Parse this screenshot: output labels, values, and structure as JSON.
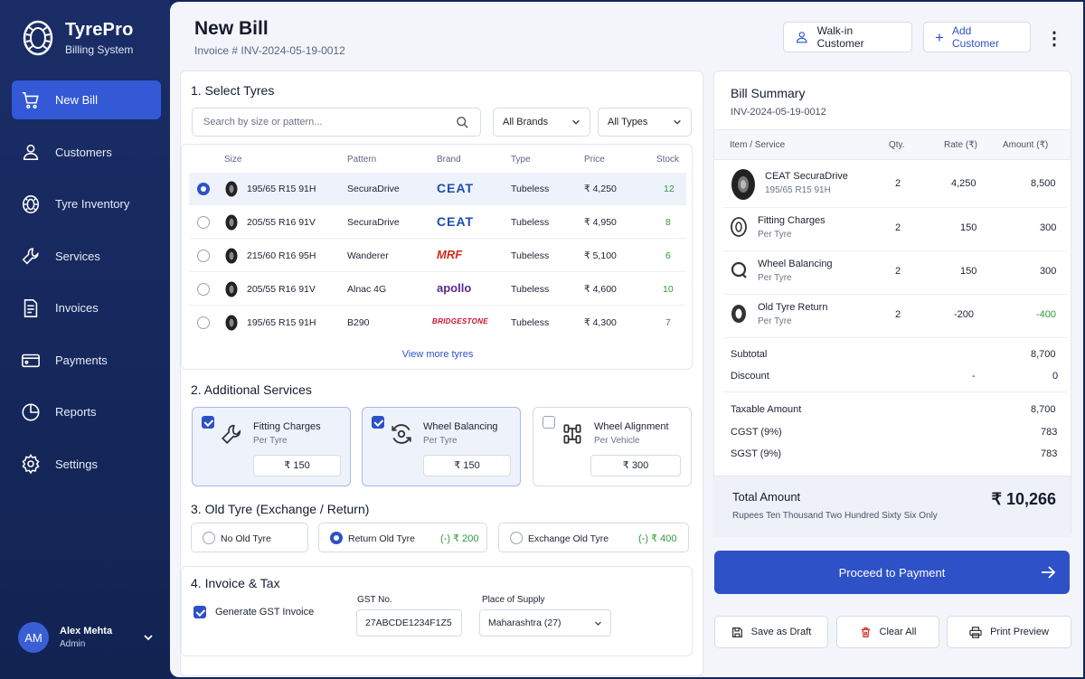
{
  "app": {
    "name": "TyrePro",
    "subtitle": "Billing System"
  },
  "sidebar": {
    "items": [
      {
        "label": "New Bill",
        "icon": "cart-icon",
        "active": true
      },
      {
        "label": "Customers",
        "icon": "user-icon"
      },
      {
        "label": "Tyre Inventory",
        "icon": "tyre-icon"
      },
      {
        "label": "Services",
        "icon": "wrench-icon"
      },
      {
        "label": "Invoices",
        "icon": "invoice-icon"
      },
      {
        "label": "Payments",
        "icon": "wallet-icon"
      },
      {
        "label": "Reports",
        "icon": "pie-chart-icon"
      },
      {
        "label": "Settings",
        "icon": "gear-icon"
      }
    ]
  },
  "user": {
    "initials": "AM",
    "name": "Alex Mehta",
    "role": "Admin"
  },
  "header": {
    "title": "New Bill",
    "invoice": "Invoice # INV-2024-05-19-0012",
    "walkin_label": "Walk-in Customer",
    "add_customer_label": "Add Customer"
  },
  "tyres": {
    "section_title": "1. Select Tyres",
    "search_placeholder": "Search by size or pattern...",
    "brand_filter": "All Brands",
    "type_filter": "All Types",
    "columns": [
      "Size",
      "Pattern",
      "Brand",
      "Type",
      "Price",
      "Stock"
    ],
    "rows": [
      {
        "size": "195/65 R15 91H",
        "pattern": "SecuraDrive",
        "brand": "CEAT",
        "type": "Tubeless",
        "price": "₹ 4,250",
        "stock": "12",
        "selected": true
      },
      {
        "size": "205/55 R16 91V",
        "pattern": "SecuraDrive",
        "brand": "CEAT",
        "type": "Tubeless",
        "price": "₹ 4,950",
        "stock": "8",
        "selected": false
      },
      {
        "size": "215/60 R16 95H",
        "pattern": "Wanderer",
        "brand": "MRF",
        "type": "Tubeless",
        "price": "₹ 5,100",
        "stock": "6",
        "selected": false
      },
      {
        "size": "205/55 R16 91V",
        "pattern": "Alnac 4G",
        "brand": "apollo",
        "type": "Tubeless",
        "price": "₹ 4,600",
        "stock": "10",
        "selected": false
      },
      {
        "size": "195/65 R15 91H",
        "pattern": "B290",
        "brand": "BRIDGESTONE",
        "type": "Tubeless",
        "price": "₹ 4,300",
        "stock": "7",
        "selected": false
      }
    ],
    "view_more": "View more tyres"
  },
  "services": {
    "section_title": "2. Additional Services",
    "items": [
      {
        "name": "Fitting Charges",
        "unit": "Per Tyre",
        "price": "₹ 150",
        "checked": true,
        "icon": "wrench-icon"
      },
      {
        "name": "Wheel Balancing",
        "unit": "Per Tyre",
        "price": "₹ 150",
        "checked": true,
        "icon": "balancing-icon"
      },
      {
        "name": "Wheel Alignment",
        "unit": "Per Vehicle",
        "price": "₹ 300",
        "checked": false,
        "icon": "alignment-icon"
      }
    ]
  },
  "old_tyre": {
    "section_title": "3. Old Tyre (Exchange / Return)",
    "options": [
      {
        "label": "No Old Tyre",
        "price": "",
        "selected": false
      },
      {
        "label": "Return Old Tyre",
        "price": "(-) ₹ 200",
        "selected": true
      },
      {
        "label": "Exchange Old Tyre",
        "price": "(-) ₹ 400",
        "selected": false
      }
    ]
  },
  "invoice_tax": {
    "section_title": "4. Invoice & Tax",
    "gst_invoice_label": "Generate GST Invoice",
    "gst_label": "GST No.",
    "gst_value": "27ABCDE1234F1Z5",
    "supply_label": "Place of Supply",
    "supply_value": "Maharashtra (27)"
  },
  "summary": {
    "title": "Bill Summary",
    "invoice": "INV-2024-05-19-0012",
    "columns": [
      "Item / Service",
      "Qty.",
      "Rate (₹)",
      "Amount (₹)"
    ],
    "items": [
      {
        "name": "CEAT SecuraDrive",
        "unit": "195/65 R15 91H",
        "qty": "2",
        "rate": "4,250",
        "amount": "8,500"
      },
      {
        "name": "Fitting Charges",
        "unit": "Per Tyre",
        "qty": "2",
        "rate": "150",
        "amount": "300"
      },
      {
        "name": "Wheel Balancing",
        "unit": "Per Tyre",
        "qty": "2",
        "rate": "150",
        "amount": "300"
      },
      {
        "name": "Old Tyre Return",
        "unit": "Per Tyre",
        "qty": "2",
        "rate": "-200",
        "amount": "-400"
      }
    ],
    "subtotal_label": "Subtotal",
    "subtotal": "8,700",
    "discount_label": "Discount",
    "discount_rate": "-",
    "discount": "0",
    "taxable_label": "Taxable Amount",
    "taxable": "8,700",
    "cgst_label": "CGST (9%)",
    "cgst": "783",
    "sgst_label": "SGST (9%)",
    "sgst": "783",
    "total_label": "Total Amount",
    "total": "₹ 10,266",
    "total_words": "Rupees Ten Thousand Two Hundred Sixty Six Only"
  },
  "actions": {
    "proceed": "Proceed to Payment",
    "draft": "Save as Draft",
    "clear": "Clear All",
    "print": "Print Preview"
  },
  "colors": {
    "primary": "#2f51c8",
    "sidebar": "#1a2d66",
    "green": "#2d9a3c",
    "ceat": "#1d4fa8",
    "mrf": "#d12a1f",
    "apollo": "#5a2a8c"
  }
}
